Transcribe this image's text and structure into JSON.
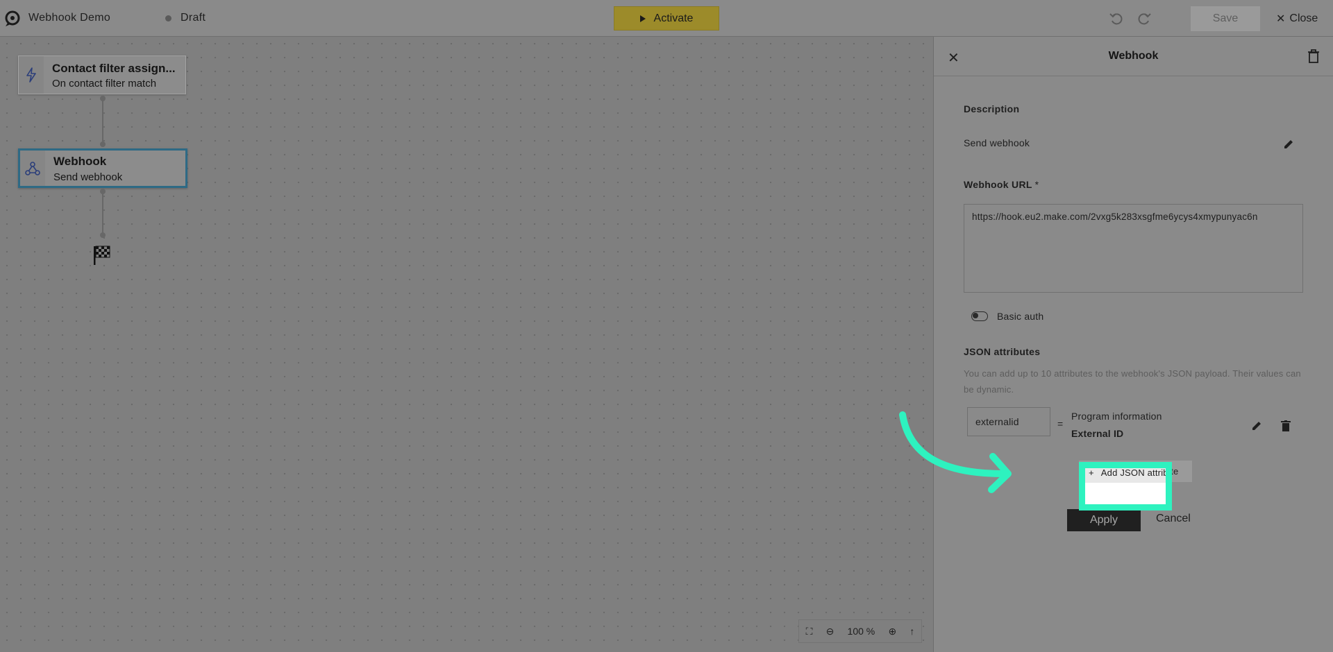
{
  "app": {
    "title": "Webhook Demo",
    "status": "Draft",
    "activate_label": "Activate",
    "save_label": "Save",
    "close_label": "Close"
  },
  "canvas": {
    "trigger_node": {
      "title": "Contact filter assign...",
      "subtitle": "On contact filter match"
    },
    "webhook_node": {
      "title": "Webhook",
      "subtitle": "Send webhook"
    },
    "zoom_level": "100 %"
  },
  "panel": {
    "title": "Webhook",
    "description_label": "Description",
    "description_value": "Send webhook",
    "url_label": "Webhook URL",
    "url_required": "*",
    "url_value": "https://hook.eu2.make.com/2vxg5k283xsgfme6ycys4xmypunyac6n",
    "basic_auth_label": "Basic auth",
    "json_label": "JSON attributes",
    "json_hint": "You can add up to 10 attributes to the webhook's JSON payload. Their values can be dynamic.",
    "attributes": [
      {
        "key": "externalid",
        "value_line1": "Program information",
        "value_line2": "External ID"
      }
    ],
    "add_json_label": "Add JSON attribute",
    "apply_label": "Apply",
    "cancel_label": "Cancel"
  },
  "colors": {
    "highlight": "#2ef2bf",
    "activate": "#f5c400",
    "selected_node_border": "#2e6a85"
  }
}
